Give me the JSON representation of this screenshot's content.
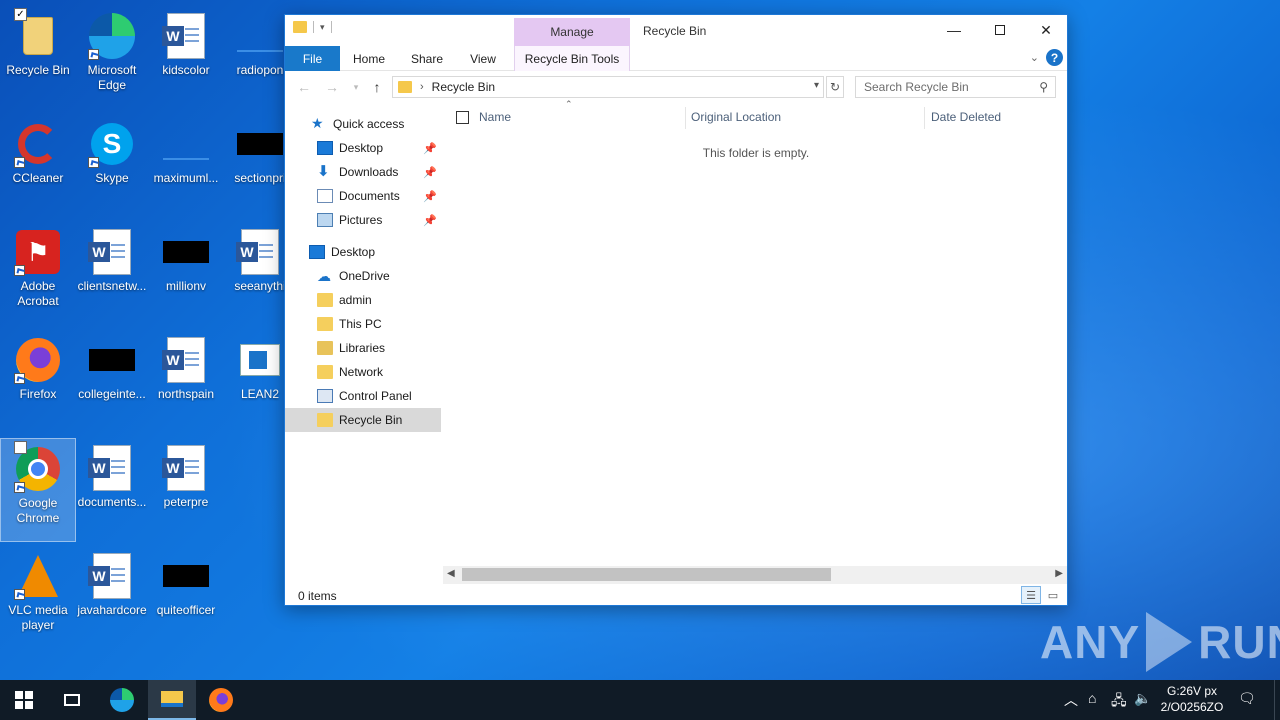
{
  "desktop": {
    "icons": [
      {
        "label": "Recycle Bin"
      },
      {
        "label": "Microsoft Edge"
      },
      {
        "label": "kidscolor"
      },
      {
        "label": "radiopon"
      },
      {
        "label": "CCleaner"
      },
      {
        "label": "Skype"
      },
      {
        "label": "maximuml..."
      },
      {
        "label": "sectionpri"
      },
      {
        "label": "Adobe Acrobat"
      },
      {
        "label": "clientsnetw..."
      },
      {
        "label": "millionv"
      },
      {
        "label": "seeanythi"
      },
      {
        "label": "Firefox"
      },
      {
        "label": "collegeinte..."
      },
      {
        "label": "northspain"
      },
      {
        "label": "LEAN2"
      },
      {
        "label": "Google Chrome"
      },
      {
        "label": "documents..."
      },
      {
        "label": "peterpre"
      },
      {
        "label": "VLC media player"
      },
      {
        "label": "javahardcore"
      },
      {
        "label": "quiteofficer"
      }
    ]
  },
  "window": {
    "title": "Recycle Bin",
    "context_tab": "Manage",
    "ribbon_tabs": [
      "File",
      "Home",
      "Share",
      "View",
      "Recycle Bin Tools"
    ],
    "help": "?",
    "address": "Recycle Bin",
    "search_placeholder": "Search Recycle Bin",
    "nav": [
      {
        "label": "Quick access",
        "icon": "star-icon"
      },
      {
        "label": "Desktop",
        "icon": "desktop-icon",
        "pinned": true
      },
      {
        "label": "Downloads",
        "icon": "download-icon",
        "pinned": true
      },
      {
        "label": "Documents",
        "icon": "documents-icon",
        "pinned": true
      },
      {
        "label": "Pictures",
        "icon": "pictures-icon",
        "pinned": true
      },
      {
        "label": "Desktop",
        "icon": "desktop-icon"
      },
      {
        "label": "OneDrive",
        "icon": "cloud-icon"
      },
      {
        "label": "admin",
        "icon": "folder-icon"
      },
      {
        "label": "This PC",
        "icon": "folder-icon"
      },
      {
        "label": "Libraries",
        "icon": "libraries-icon"
      },
      {
        "label": "Network",
        "icon": "folder-icon"
      },
      {
        "label": "Control Panel",
        "icon": "control-panel-icon"
      },
      {
        "label": "Recycle Bin",
        "icon": "folder-icon",
        "selected": true
      }
    ],
    "columns": [
      "Name",
      "Original Location",
      "Date Deleted"
    ],
    "empty_message": "This folder is empty.",
    "status": "0 items"
  },
  "watermark": {
    "left": "ANY",
    "right": "RUN"
  },
  "taskbar": {
    "clock_time": "G:26V px",
    "clock_date": "2/O0256ZO"
  }
}
